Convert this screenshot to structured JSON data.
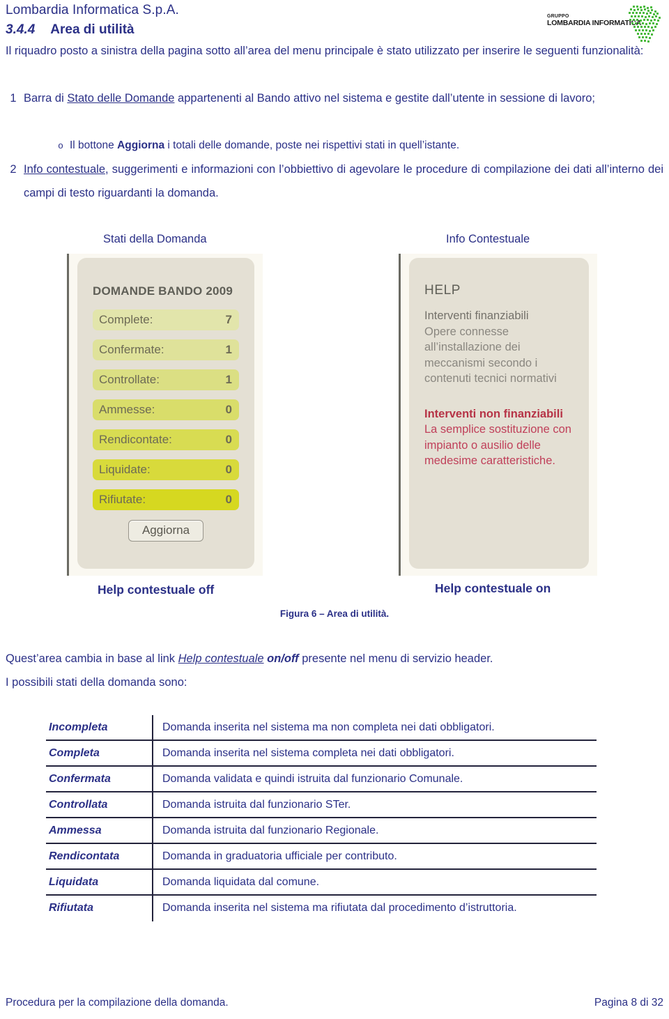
{
  "header": {
    "company": "Lombardia Informatica S.p.A.",
    "section_number": "3.4.4",
    "section_title": "Area di utilità",
    "logo": {
      "gruppo": "GRUPPO",
      "name": "LOMBARDIA INFORMATICA",
      "map_color": "#4cba3f"
    }
  },
  "intro": {
    "text": "Il riquadro posto a sinistra della pagina sotto all’area del menu principale è stato utilizzato per inserire le seguenti funzionalità:"
  },
  "list": {
    "item1": {
      "num": "1",
      "pre": "Barra di ",
      "link": "Stato delle Domande",
      "post": " appartenenti al Bando attivo nel sistema e gestite dall’utente in sessione di lavoro;"
    },
    "sub1": {
      "bullet": "o",
      "pre": "Il bottone ",
      "bold": "Aggiorna",
      "post": " i totali delle domande, poste nei rispettivi stati in quell’istante."
    },
    "item2": {
      "num": "2",
      "link": "Info contestuale",
      "post": ", suggerimenti e informazioni con l’obbiettivo di agevolare le procedure di compilazione dei dati all’interno dei campi di testo riguardanti la domanda."
    }
  },
  "figure": {
    "label_left": "Stati della Domanda",
    "label_right": "Info Contestuale",
    "caption_off": "Help contestuale off",
    "caption_on": "Help contestuale on",
    "caption": "Figura 6 – Area di utilità."
  },
  "status_panel": {
    "title": "DOMANDE BANDO 2009",
    "button_label": "Aggiorna",
    "bars": [
      {
        "label": "Complete:",
        "value": "7",
        "color": "#e2e5ab"
      },
      {
        "label": "Confermate:",
        "value": "1",
        "color": "#dfe29a"
      },
      {
        "label": "Controllate:",
        "value": "1",
        "color": "#dbdf83"
      },
      {
        "label": "Ammesse:",
        "value": "0",
        "color": "#d9dd6a"
      },
      {
        "label": "Rendicontate:",
        "value": "0",
        "color": "#d8dc52"
      },
      {
        "label": "Liquidate:",
        "value": "0",
        "color": "#d8da3b"
      },
      {
        "label": "Rifiutate:",
        "value": "0",
        "color": "#d6d820"
      }
    ]
  },
  "help_panel": {
    "title": "HELP",
    "section1_heading": "Interventi finanziabili",
    "section1_text": "Opere connesse all’installazione dei meccanismi secondo i contenuti tecnici normativi",
    "section2_heading": "Interventi non finanziabili",
    "section2_text": "La semplice sostituzione con impianto o ausilio delle medesime caratteristiche."
  },
  "after_figure": {
    "line1_pre": "Quest’area cambia in base al link ",
    "line1_link": "Help contestuale",
    "line1_bold": " on/off",
    "line1_post": " presente nel menu di servizio header.",
    "line2": "I possibili stati della domanda sono:"
  },
  "states": [
    {
      "name": "Incompleta",
      "desc": "Domanda inserita nel sistema ma non completa nei dati obbligatori."
    },
    {
      "name": "Completa",
      "desc": "Domanda inserita nel sistema completa nei dati obbligatori."
    },
    {
      "name": "Confermata",
      "desc": "Domanda validata e quindi istruita dal funzionario Comunale."
    },
    {
      "name": "Controllata",
      "desc": "Domanda istruita dal funzionario STer."
    },
    {
      "name": "Ammessa",
      "desc": "Domanda istruita dal funzionario Regionale."
    },
    {
      "name": "Rendicontata",
      "desc": "Domanda in graduatoria ufficiale per contributo."
    },
    {
      "name": "Liquidata",
      "desc": "Domanda liquidata dal comune."
    },
    {
      "name": "Rifiutata",
      "desc": "Domanda inserita nel sistema ma rifiutata dal procedimento d’istruttoria."
    }
  ],
  "footer": {
    "left": "Procedura per la compilazione della domanda.",
    "right": "Pagina 8 di 32"
  }
}
